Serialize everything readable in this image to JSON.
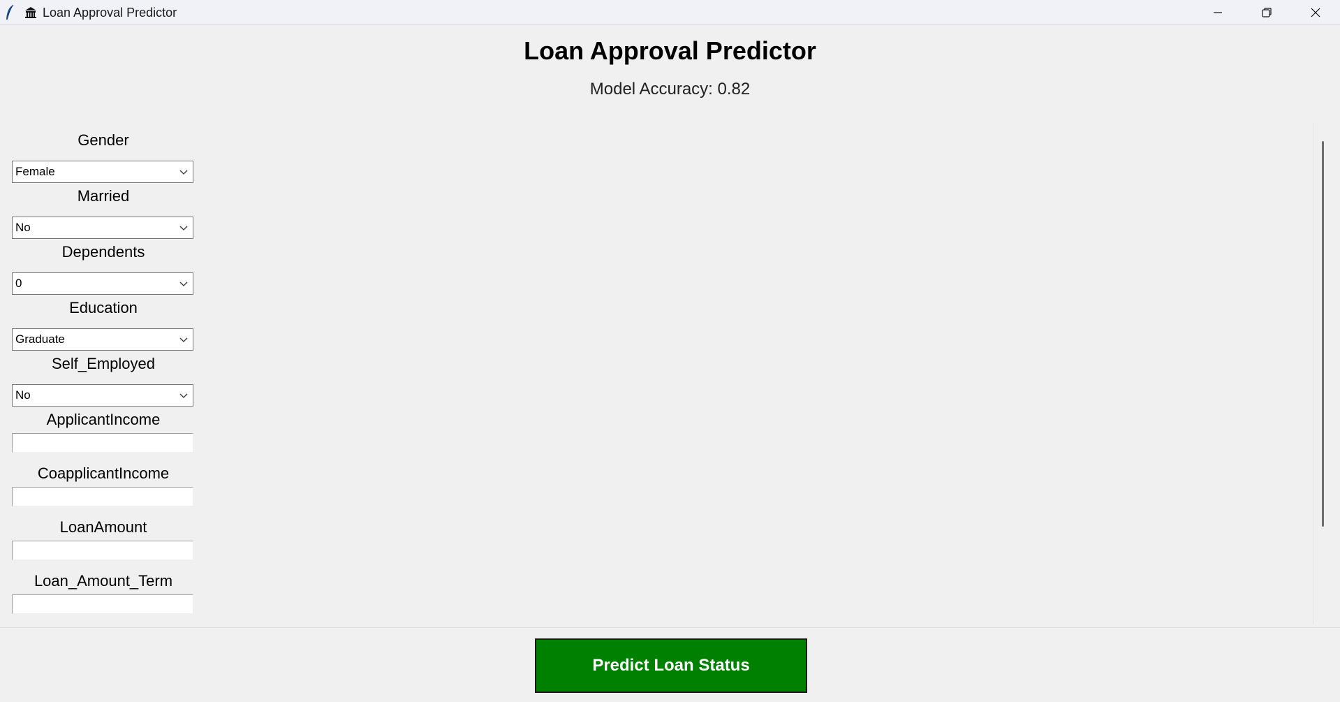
{
  "window": {
    "title": "Loan Approval Predictor",
    "title_icon": "bank-icon",
    "app_icon": "feather-icon",
    "controls": [
      "minimize-icon",
      "restore-icon",
      "close-icon"
    ]
  },
  "header": {
    "title": "Loan Approval Predictor",
    "accuracy": "Model Accuracy: 0.82"
  },
  "form": {
    "gender": {
      "label": "Gender",
      "value": "Female"
    },
    "married": {
      "label": "Married",
      "value": "No"
    },
    "dependents": {
      "label": "Dependents",
      "value": "0"
    },
    "education": {
      "label": "Education",
      "value": "Graduate"
    },
    "self_employed": {
      "label": "Self_Employed",
      "value": "No"
    },
    "applicant_income": {
      "label": "ApplicantIncome",
      "value": ""
    },
    "coapplicant_income": {
      "label": "CoapplicantIncome",
      "value": ""
    },
    "loan_amount": {
      "label": "LoanAmount",
      "value": ""
    },
    "loan_amount_term": {
      "label": "Loan_Amount_Term",
      "value": ""
    }
  },
  "actions": {
    "predict_label": "Predict Loan Status"
  },
  "colors": {
    "predict_button": "#008000",
    "background": "#f0f0f0"
  }
}
